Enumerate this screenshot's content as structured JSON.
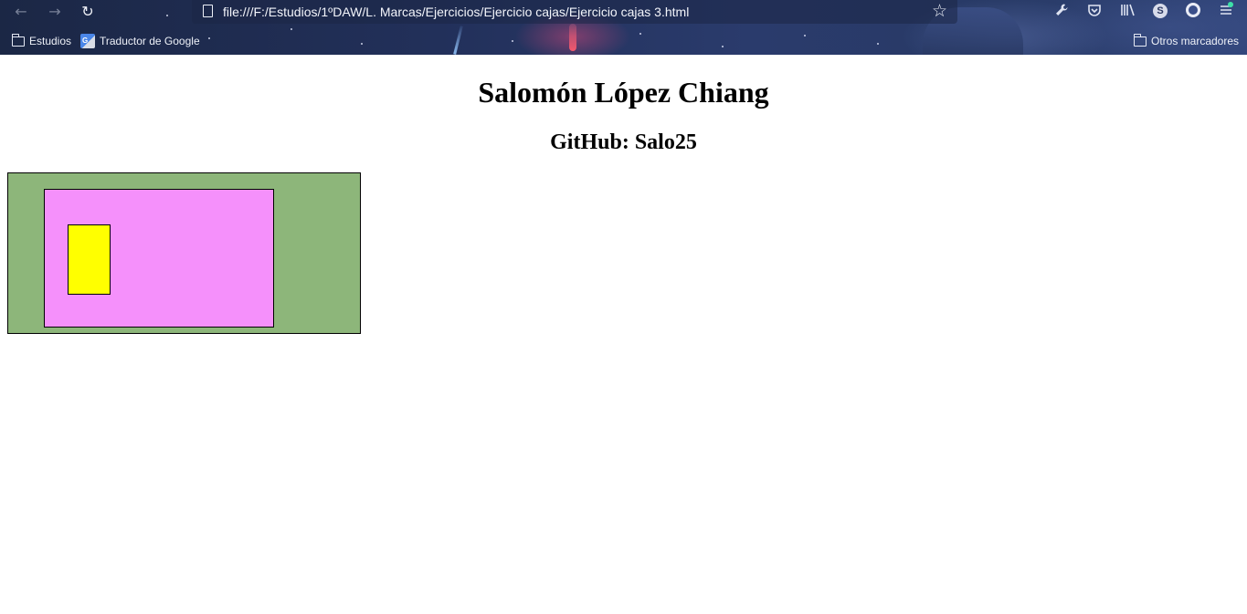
{
  "browser": {
    "url": "file:///F:/Estudios/1ºDAW/L. Marcas/Ejercicios/Ejercicio cajas/Ejercicio cajas 3.html",
    "nav": {
      "back_icon": "back-arrow-icon",
      "forward_icon": "forward-arrow-icon",
      "reload_icon": "reload-icon"
    },
    "toolbar_icons": [
      "wrench-icon",
      "pocket-icon",
      "library-icon",
      "account-icon",
      "extension-icon",
      "menu-icon"
    ],
    "account_initial": "S",
    "bookmarks": [
      {
        "label": "Estudios",
        "icon": "folder-icon"
      },
      {
        "label": "Traductor de Google",
        "icon": "google-translate-icon"
      }
    ],
    "other_bookmarks": {
      "label": "Otros marcadores",
      "icon": "folder-icon"
    }
  },
  "page": {
    "title": "Salomón López Chiang",
    "subtitle": "GitHub: Salo25",
    "boxes": {
      "outer_color": "#8db67a",
      "middle_color": "#f590fb",
      "inner_color": "#ffff00"
    }
  }
}
